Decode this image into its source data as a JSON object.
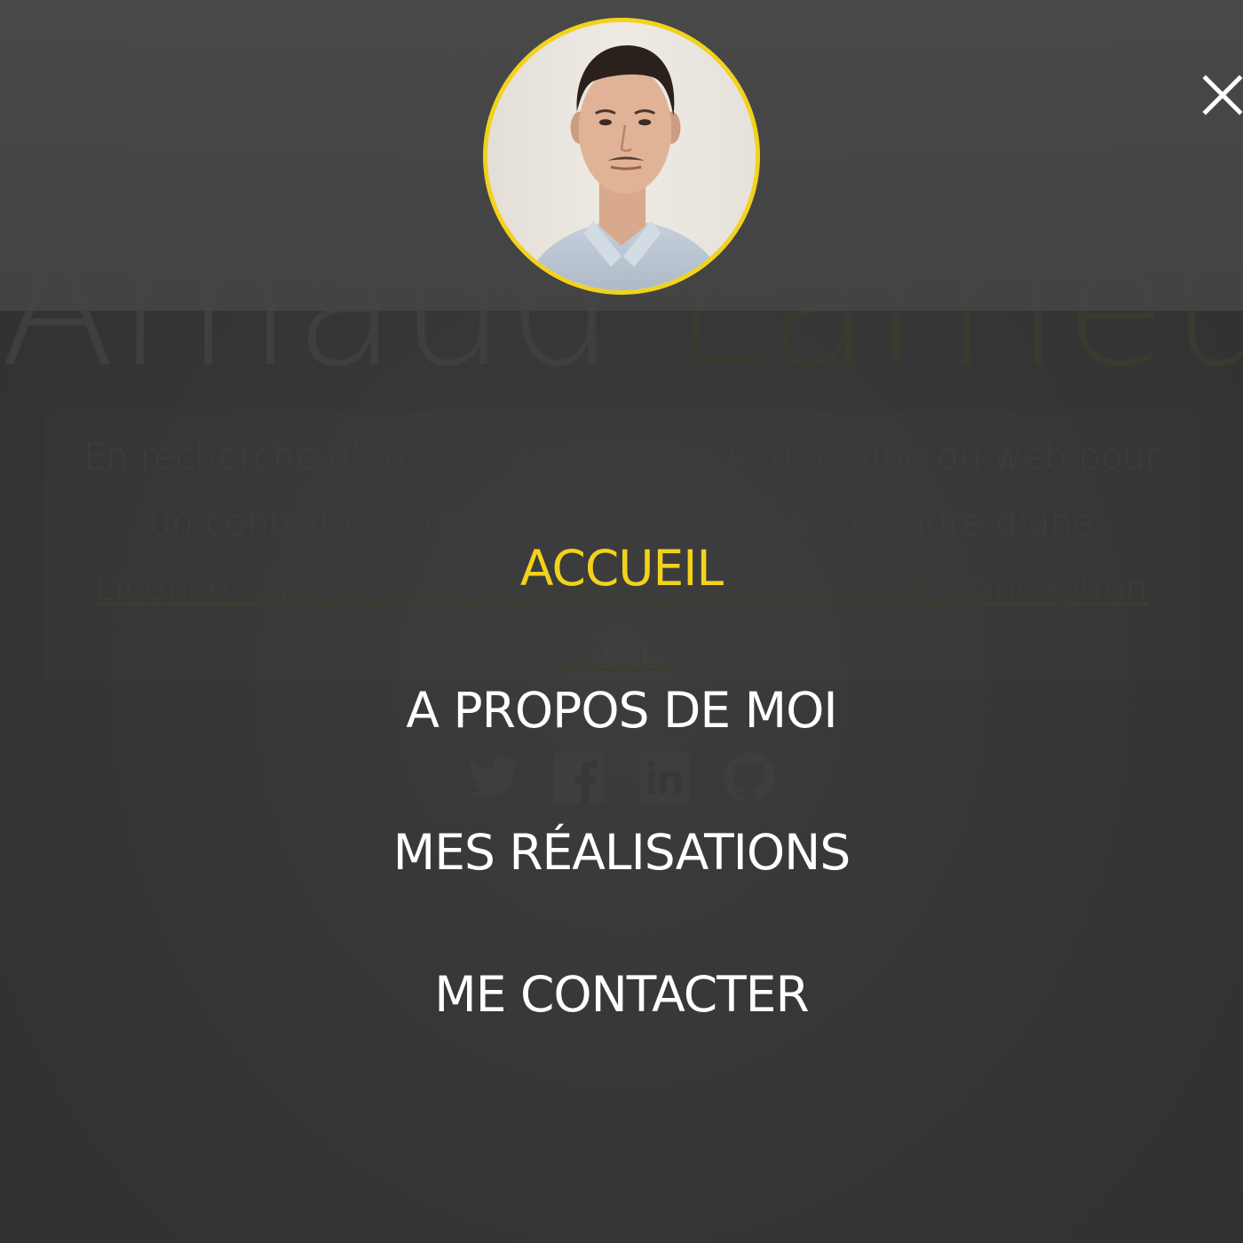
{
  "background_page": {
    "hero_first_name": "Arnaud",
    "hero_last_name": "Larrieu",
    "intro_text": "En recherche d'une entreprise dans le domaine du web pour un contrat de professionalisation dans le cadre d'une",
    "intro_link": "Licence Chef de projet en Marketing Internet et Conception de site",
    "social_icons": [
      "twitter-icon",
      "facebook-icon",
      "linkedin-icon",
      "github-icon"
    ]
  },
  "overlay_menu": {
    "close_icon": "close-icon",
    "items": [
      {
        "label": "ACCUEIL",
        "active": true
      },
      {
        "label": "A PROPOS DE MOI",
        "active": false
      },
      {
        "label": "MES RÉALISATIONS",
        "active": false
      },
      {
        "label": "ME CONTACTER",
        "active": false
      }
    ]
  },
  "colors": {
    "accent": "#f2d21c",
    "menu_text": "#ffffff",
    "overlay_bg": "#353535",
    "top_band": "#474747"
  }
}
